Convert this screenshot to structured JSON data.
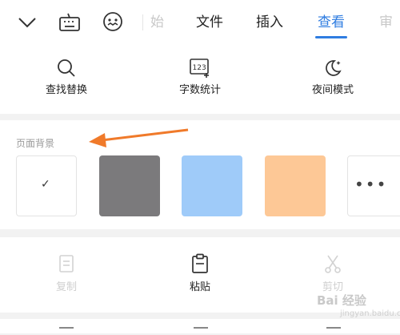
{
  "toolbar": {
    "icons": [
      "chevron-down-icon",
      "keyboard-icon",
      "face-icon"
    ],
    "tabs": [
      {
        "label": "始",
        "state": "faded"
      },
      {
        "label": "文件",
        "state": "normal"
      },
      {
        "label": "插入",
        "state": "normal"
      },
      {
        "label": "查看",
        "state": "active"
      },
      {
        "label": "审",
        "state": "faded"
      }
    ],
    "accent_color": "#2f7de1"
  },
  "tools": [
    {
      "label": "查找替换",
      "icon": "search-icon"
    },
    {
      "label": "字数统计",
      "icon": "word-count-icon",
      "icon_text": "123"
    },
    {
      "label": "夜间模式",
      "icon": "moon-icon"
    }
  ],
  "page_background": {
    "title": "页面背景",
    "swatches": [
      {
        "name": "white",
        "color": "#ffffff",
        "selected": true
      },
      {
        "name": "gray",
        "color": "#7b7a7c",
        "selected": false
      },
      {
        "name": "blue",
        "color": "#9fcbf9",
        "selected": false
      },
      {
        "name": "orange",
        "color": "#fdc896",
        "selected": false
      }
    ],
    "check_mark": "✓",
    "more_label": "•••"
  },
  "clipboard": [
    {
      "label": "复制",
      "enabled": false,
      "icon": "copy-icon"
    },
    {
      "label": "粘贴",
      "enabled": true,
      "icon": "paste-icon"
    },
    {
      "label": "剪切",
      "enabled": false,
      "icon": "scissors-icon"
    }
  ],
  "annotation": {
    "arrow_color": "#f07a2a"
  },
  "watermark": {
    "main": "Bai 经验",
    "sub": "jingyan.baidu.com"
  }
}
